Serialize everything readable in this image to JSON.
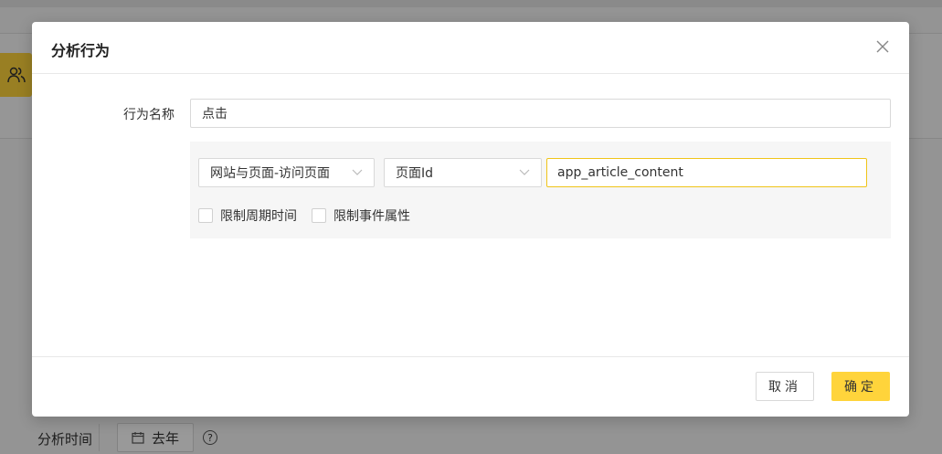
{
  "background": {
    "bottom_label": "分析时间",
    "date_button": "去年",
    "side_button_icon": "users-icon",
    "accent": "#ffd43b"
  },
  "modal": {
    "title": "分析行为",
    "close_icon": "close-icon",
    "name_label": "行为名称",
    "name_value": "点击",
    "event_select": "网站与页面-访问页面",
    "property_select": "页面Id",
    "property_value": "app_article_content",
    "checkbox_period": "限制周期时间",
    "checkbox_event_attr": "限制事件属性",
    "cancel_label": "取消",
    "ok_label": "确定"
  }
}
